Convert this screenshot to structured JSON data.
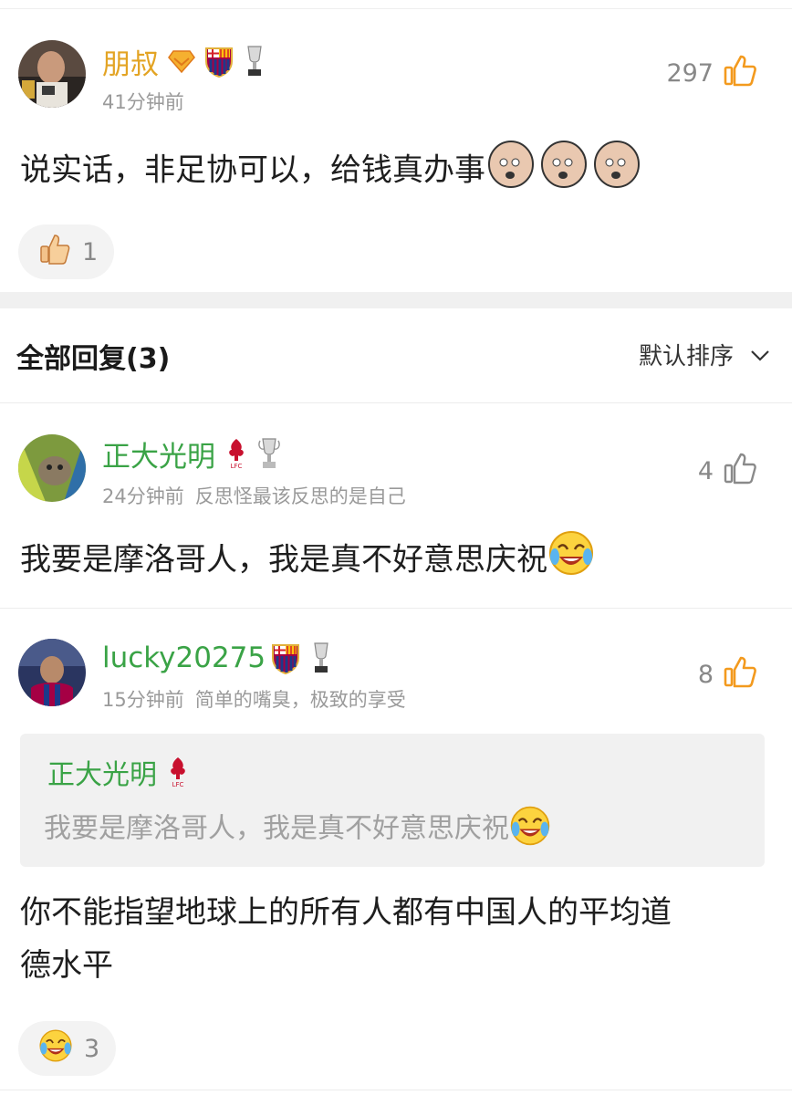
{
  "comments": [
    {
      "username": "朋叔",
      "time": "41分钟前",
      "signature": "",
      "likes": "297",
      "text": "说实话，非足协可以，给钱真办事",
      "reaction_count": "1"
    },
    {
      "username": "正大光明",
      "time": "24分钟前",
      "signature": "反思怪最该反思的是自己",
      "likes": "4",
      "text": "我要是摩洛哥人，我是真不好意思庆祝"
    },
    {
      "username": "lucky20275",
      "time": "15分钟前",
      "signature": "简单的嘴臭，极致的享受",
      "likes": "8",
      "text_line1": "你不能指望地球上的所有人都有中国人的平均道",
      "text_line2": "德水平",
      "reaction_count": "3",
      "quote": {
        "username": "正大光明",
        "text": "我要是摩洛哥人，我是真不好意思庆祝"
      }
    }
  ],
  "replies_section": {
    "title": "全部回复(3)",
    "sort_label": "默认排序"
  },
  "icons": {
    "like": "thumbs-up-icon",
    "sort_toggle": "chevron-down-icon",
    "badges": [
      "gold-diamond-badge",
      "barcelona-crest",
      "trophy-icon",
      "liverpool-crest"
    ]
  },
  "colors": {
    "username_green": "#3aa346",
    "username_gold": "#e3a424",
    "like_orange": "#f39a1e",
    "meta_grey": "#9a9a9a"
  }
}
